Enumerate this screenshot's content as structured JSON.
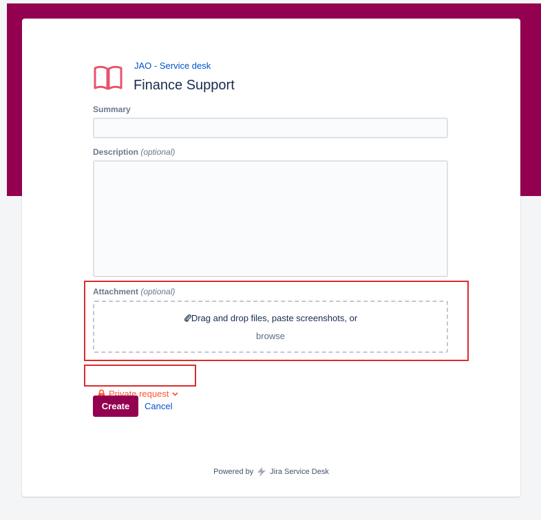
{
  "header": {
    "project_link": "JAO - Service desk",
    "form_title": "Finance Support"
  },
  "form": {
    "summary_label": "Summary",
    "summary_value": "",
    "description_label": "Description",
    "description_optional": "(optional)",
    "description_value": "",
    "attachment_label": "Attachment",
    "attachment_optional": "(optional)",
    "drop_text": "Drag and drop files, paste screenshots, or",
    "browse_label": "browse",
    "private_request_label": "Private request",
    "create_label": "Create",
    "cancel_label": "Cancel"
  },
  "footer": {
    "powered_by": "Powered by",
    "product": "Jira Service Desk"
  },
  "icons": {
    "logo": "open-book-icon",
    "attachment": "paperclip-icon",
    "private": "lock-icon",
    "private_toggle": "chevron-down-icon",
    "product": "jira-bolt-icon"
  },
  "colors": {
    "brand": "#940050",
    "link": "#0052cc",
    "private_accent": "#ff5630",
    "highlight": "#d92b2b"
  }
}
